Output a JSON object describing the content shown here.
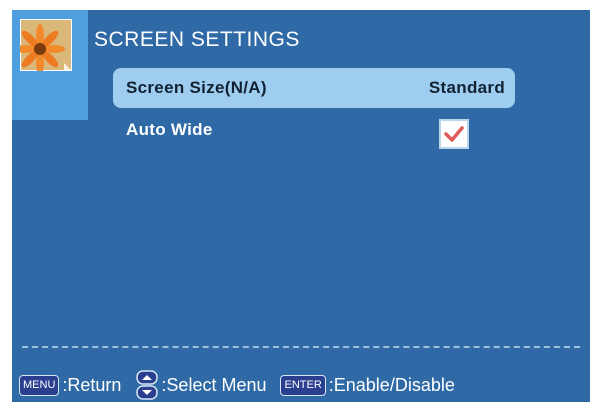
{
  "title": "SCREEN SETTINGS",
  "menu_items": [
    {
      "label": "Screen Size(N/A)",
      "value": "Standard",
      "selected": true
    },
    {
      "label": "Auto Wide",
      "checked": true
    }
  ],
  "thumbnail_icon": "flower-picture-icon",
  "footer": {
    "menu_key": "MENU",
    "menu_action": ":Return",
    "nav_icon": "up-down-arrows-icon",
    "nav_action": ":Select Menu",
    "enter_key": "ENTER",
    "enter_action": ":Enable/Disable"
  },
  "colors": {
    "background": "#2f6aa6",
    "thumbnail_panel": "#4f9ee0",
    "selected_row": "#9fcdf0",
    "checkmark": "#e05a5a"
  }
}
